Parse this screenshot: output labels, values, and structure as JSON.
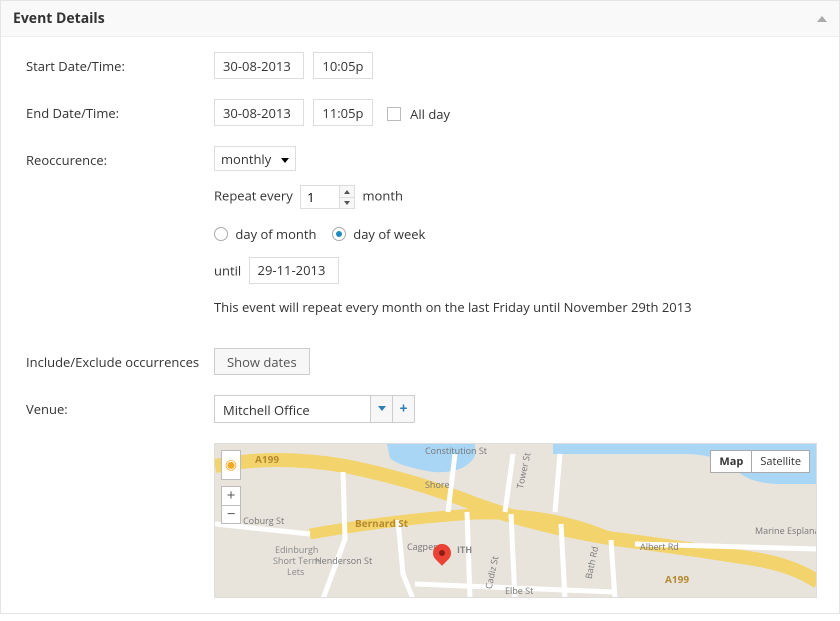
{
  "panel": {
    "title": "Event Details"
  },
  "labels": {
    "start": "Start Date/Time:",
    "end": "End Date/Time:",
    "reoccur": "Reoccurence:",
    "include_exclude": "Include/Exclude occurrences",
    "venue": "Venue:",
    "repeat_every_prefix": "Repeat every",
    "repeat_every_suffix": "month",
    "until": "until",
    "all_day": "All day",
    "day_of_month": "day of month",
    "day_of_week": "day of week"
  },
  "values": {
    "start_date": "30-08-2013",
    "start_time": "10:05pm",
    "end_date": "30-08-2013",
    "end_time": "11:05pm",
    "recurrence_freq": "monthly",
    "repeat_interval": "1",
    "repeat_by": "day_of_week",
    "until_date": "29-11-2013",
    "venue": "Mitchell Office"
  },
  "summary": "This event will repeat every month on the last Friday until November 29th 2013",
  "buttons": {
    "show_dates": "Show dates"
  },
  "map": {
    "types": {
      "map": "Map",
      "satellite": "Satellite"
    },
    "roads": {
      "bernard": "Bernard St",
      "coburg": "Coburg St",
      "henderson": "Henderson St",
      "shore": "Shore",
      "tower": "Tower St",
      "constitution": "Constitution St",
      "bath": "Bath Rd",
      "albert": "Albert Rd",
      "cadiz": "Cadiz St",
      "elbe": "Elbe St",
      "marine": "Marine Esplanade",
      "cagper": "Cagper...",
      "a199a": "A199",
      "a199b": "A199",
      "ith": "ITH",
      "edinburgh": "Edinburgh",
      "shortterm": "Short Term",
      "lets": "Lets"
    }
  }
}
